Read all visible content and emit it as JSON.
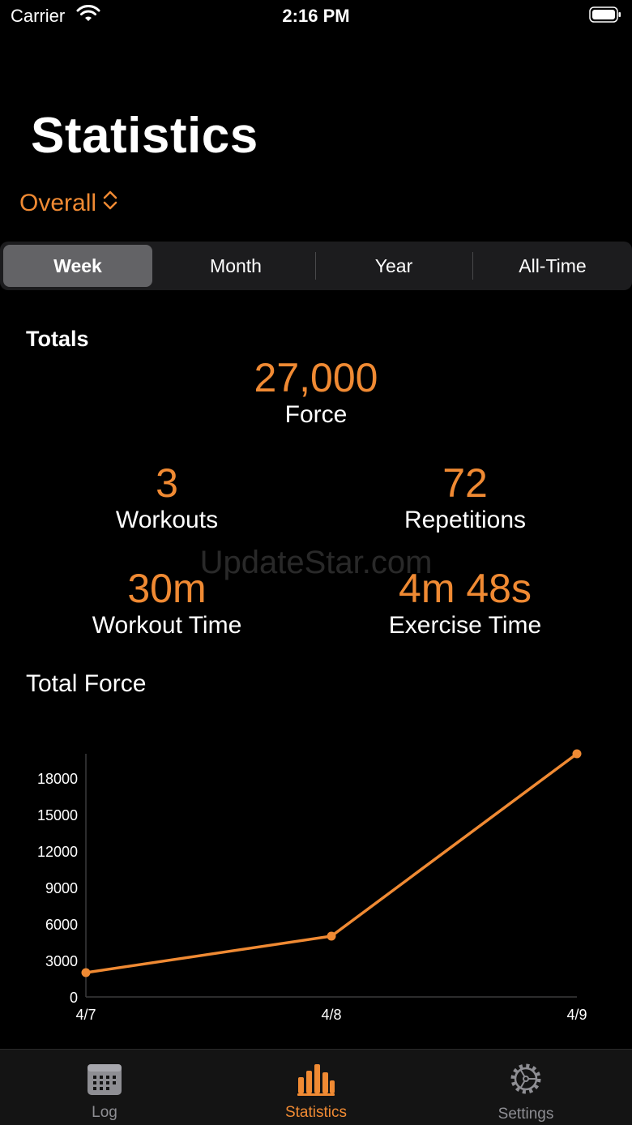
{
  "status_bar": {
    "carrier": "Carrier",
    "time": "2:16 PM"
  },
  "page_title": "Statistics",
  "scope_picker": {
    "label": "Overall"
  },
  "segments": [
    "Week",
    "Month",
    "Year",
    "All-Time"
  ],
  "selected_segment": "Week",
  "totals": {
    "header": "Totals",
    "force": {
      "value": "27,000",
      "label": "Force"
    },
    "workouts": {
      "value": "3",
      "label": "Workouts"
    },
    "repetitions": {
      "value": "72",
      "label": "Repetitions"
    },
    "workout_time": {
      "value": "30m",
      "label": "Workout Time"
    },
    "exercise_time": {
      "value": "4m 48s",
      "label": "Exercise Time"
    }
  },
  "watermark": "UpdateStar.com",
  "chart_title": "Total Force",
  "chart_data": {
    "type": "line",
    "title": "Total Force",
    "x": [
      "4/7",
      "4/8",
      "4/9"
    ],
    "series": [
      {
        "values": [
          2000,
          5000,
          20000
        ]
      }
    ],
    "yticks": [
      0,
      3000,
      6000,
      9000,
      12000,
      15000,
      18000
    ],
    "ylim": [
      0,
      20000
    ],
    "grid": false,
    "color": "#f08a33"
  },
  "tab_bar": {
    "items": [
      {
        "label": "Log",
        "icon": "calendar-icon"
      },
      {
        "label": "Statistics",
        "icon": "bar-chart-icon"
      },
      {
        "label": "Settings",
        "icon": "gear-icon"
      }
    ],
    "active_color": "#f08a33",
    "inactive_color": "#8e8e93"
  },
  "accent_color": "#f08a33"
}
